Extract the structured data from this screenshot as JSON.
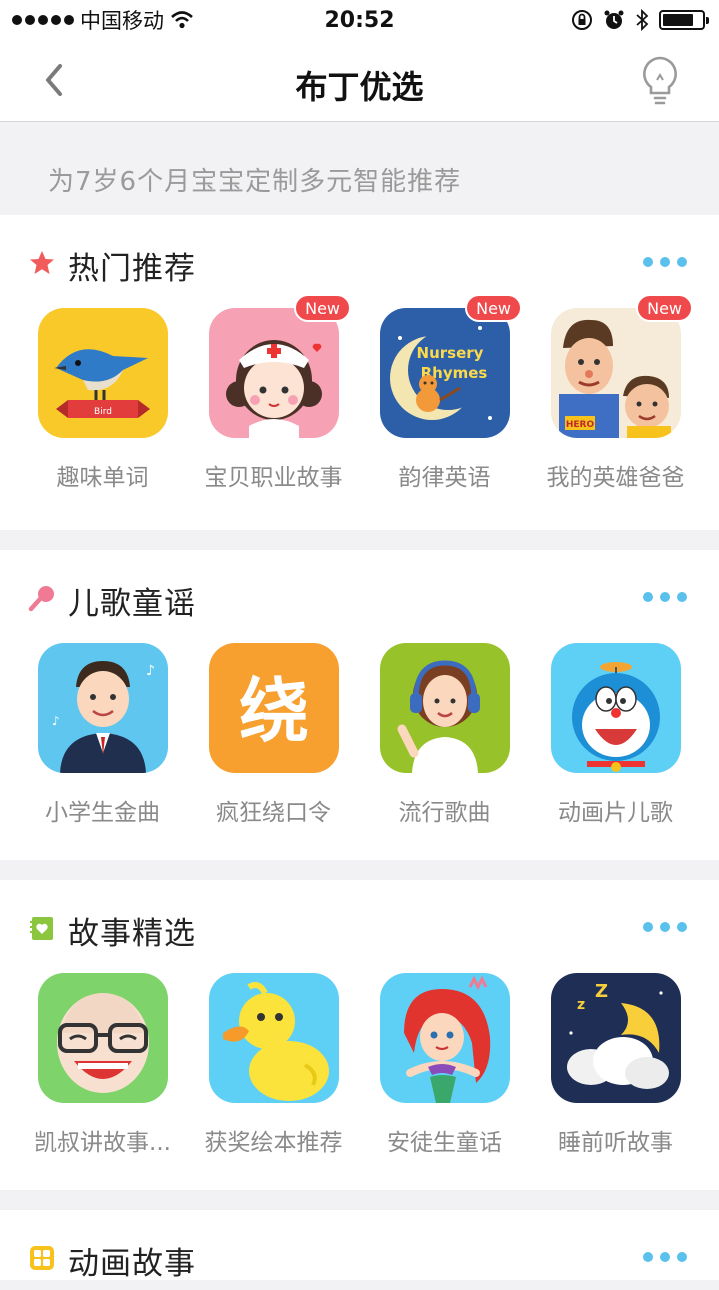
{
  "status_bar": {
    "carrier": "中国移动",
    "time": "20:52"
  },
  "nav": {
    "title": "布丁优选"
  },
  "banner": {
    "text": "为7岁6个月宝宝定制多元智能推荐"
  },
  "sections": [
    {
      "title": "热门推荐",
      "icon": "star-icon",
      "apps": [
        {
          "label": "趣味单词",
          "icon": "bird-card-icon",
          "badge": ""
        },
        {
          "label": "宝贝职业故事",
          "icon": "nurse-girl-icon",
          "badge": "New"
        },
        {
          "label": "韵律英语",
          "icon": "nursery-rhymes-icon",
          "badge": "New",
          "art_text": "Nursery Rhymes"
        },
        {
          "label": "我的英雄爸爸",
          "icon": "hero-dad-icon",
          "badge": "New",
          "art_text": "HERO"
        }
      ]
    },
    {
      "title": "儿歌童谣",
      "icon": "microphone-icon",
      "apps": [
        {
          "label": "小学生金曲",
          "icon": "schoolboy-icon",
          "badge": ""
        },
        {
          "label": "疯狂绕口令",
          "icon": "tongue-twister-icon",
          "badge": "",
          "art_text": "绕"
        },
        {
          "label": "流行歌曲",
          "icon": "headphone-girl-icon",
          "badge": ""
        },
        {
          "label": "动画片儿歌",
          "icon": "doraemon-icon",
          "badge": ""
        }
      ]
    },
    {
      "title": "故事精选",
      "icon": "heart-book-icon",
      "apps": [
        {
          "label": "凯叔讲故事...",
          "icon": "glasses-man-icon",
          "badge": ""
        },
        {
          "label": "获奖绘本推荐",
          "icon": "duck-icon",
          "badge": ""
        },
        {
          "label": "安徒生童话",
          "icon": "mermaid-icon",
          "badge": ""
        },
        {
          "label": "睡前听故事",
          "icon": "sleeping-moon-icon",
          "badge": ""
        }
      ]
    },
    {
      "title": "动画故事",
      "icon": "grid-icon",
      "apps": []
    }
  ],
  "colors": {
    "more_dots": "#5ac0ec",
    "badge": "#f0494b",
    "star": "#f25b5b",
    "mic": "#f07a93",
    "book": "#8cc63f",
    "grid": "#f8c21c"
  }
}
